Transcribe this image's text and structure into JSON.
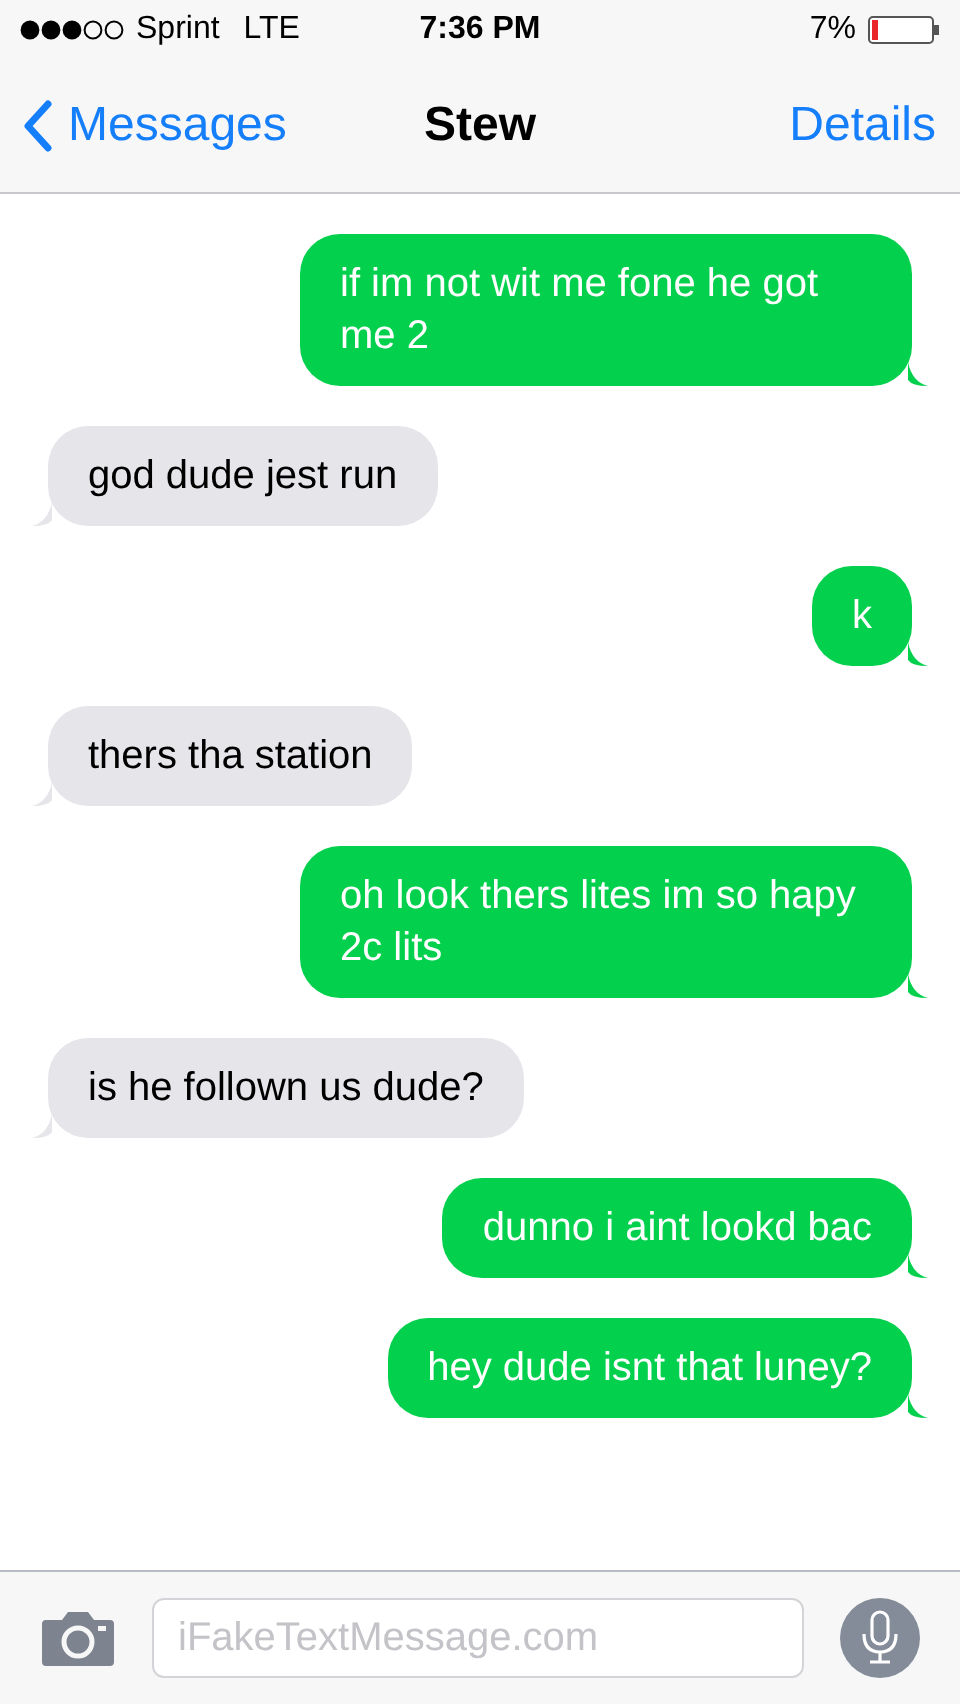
{
  "status_bar": {
    "carrier": "Sprint",
    "network": "LTE",
    "time": "7:36 PM",
    "battery_percent": "7%"
  },
  "nav": {
    "back": "Messages",
    "title": "Stew",
    "action": "Details"
  },
  "messages": [
    {
      "kind": "sent",
      "text": "if im not wit me fone he got me 2"
    },
    {
      "kind": "received",
      "text": "god dude jest run"
    },
    {
      "kind": "sent",
      "text": "k"
    },
    {
      "kind": "received",
      "text": "thers tha station"
    },
    {
      "kind": "sent",
      "text": "oh look thers lites im so hapy 2c lits"
    },
    {
      "kind": "received",
      "text": "is he follown us dude?"
    },
    {
      "kind": "sent",
      "text": "dunno i aint lookd bac"
    },
    {
      "kind": "sent",
      "text": "hey dude isnt that luney?"
    }
  ],
  "composer": {
    "placeholder": "iFakeTextMessage.com"
  }
}
